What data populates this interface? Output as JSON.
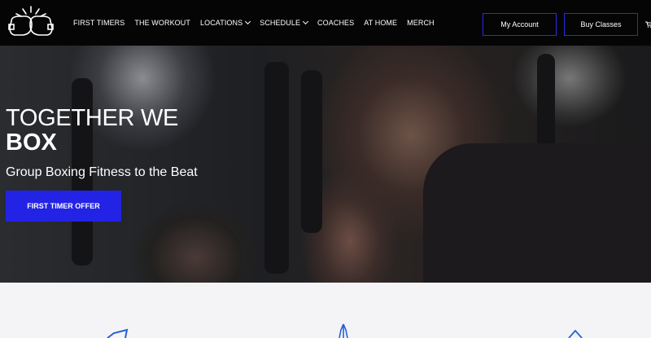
{
  "nav": {
    "items": [
      {
        "label": "FIRST TIMERS",
        "dropdown": false
      },
      {
        "label": "THE WORKOUT",
        "dropdown": false
      },
      {
        "label": "LOCATIONS",
        "dropdown": true
      },
      {
        "label": "SCHEDULE",
        "dropdown": true
      },
      {
        "label": "COACHES",
        "dropdown": false
      },
      {
        "label": "AT HOME",
        "dropdown": false
      },
      {
        "label": "MERCH",
        "dropdown": false
      }
    ],
    "account_label": "My Account",
    "buy_label": "Buy Classes"
  },
  "hero": {
    "title_light": "TOGETHER WE",
    "title_bold": "BOX",
    "subtitle": "Group Boxing Fitness to the Beat",
    "cta_label": "FIRST TIMER OFFER"
  },
  "colors": {
    "accent": "#2323e6",
    "nav_bg": "#050505",
    "section_bg": "#f4f4f6"
  },
  "icons": [
    "boxing-gloves-logo-icon",
    "cart-icon",
    "feature-icon-left",
    "feature-icon-center",
    "feature-icon-right"
  ]
}
